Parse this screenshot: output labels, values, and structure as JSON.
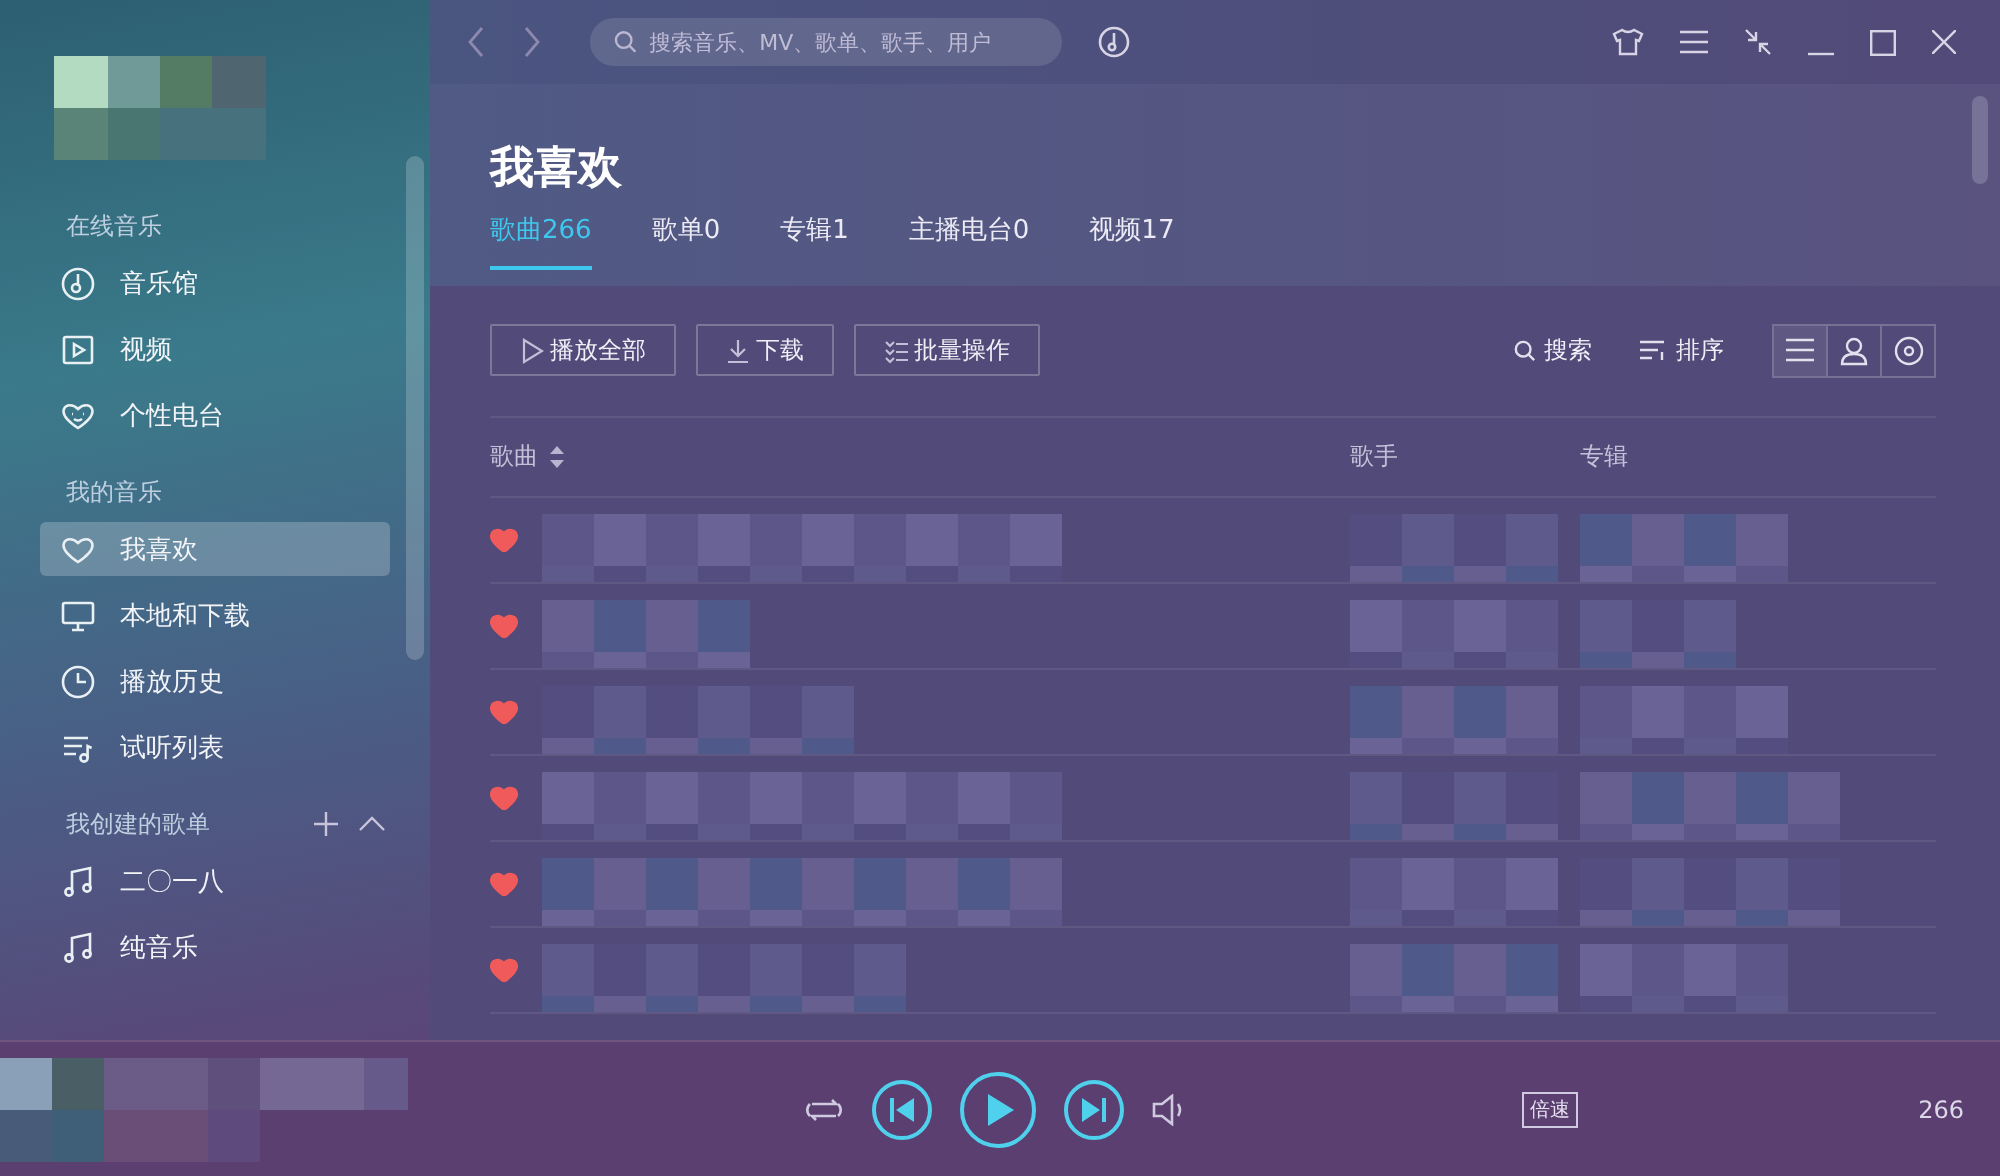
{
  "topbar": {
    "search": {
      "placeholder": "搜索音乐、MV、歌单、歌手、用户"
    }
  },
  "sidebar": {
    "sections": [
      {
        "title": "在线音乐",
        "items": [
          {
            "label": "音乐馆",
            "selected": false
          },
          {
            "label": "视频",
            "selected": false
          },
          {
            "label": "个性电台",
            "selected": false
          }
        ]
      },
      {
        "title": "我的音乐",
        "items": [
          {
            "label": "我喜欢",
            "selected": true
          },
          {
            "label": "本地和下载",
            "selected": false
          },
          {
            "label": "播放历史",
            "selected": false
          },
          {
            "label": "试听列表",
            "selected": false
          }
        ]
      },
      {
        "title": "我创建的歌单",
        "actions": true,
        "items": [
          {
            "label": "二〇一八",
            "selected": false
          },
          {
            "label": "纯音乐",
            "selected": false
          }
        ]
      }
    ]
  },
  "page": {
    "title": "我喜欢",
    "tabs": [
      {
        "label": "歌曲266",
        "selected": true
      },
      {
        "label": "歌单0",
        "selected": false
      },
      {
        "label": "专辑1",
        "selected": false
      },
      {
        "label": "主播电台0",
        "selected": false
      },
      {
        "label": "视频17",
        "selected": false
      }
    ]
  },
  "toolbar": {
    "buttons": [
      {
        "label": "播放全部"
      },
      {
        "label": "下载"
      },
      {
        "label": "批量操作"
      }
    ],
    "search": "搜索",
    "sort": "排序"
  },
  "table": {
    "columns": [
      "歌曲",
      "歌手",
      "专辑"
    ],
    "rows": [
      {
        "liked": true,
        "kind": "picture"
      },
      {
        "liked": true,
        "kind": "picture"
      },
      {
        "liked": true,
        "kind": "picture"
      },
      {
        "liked": true,
        "kind": "picture"
      },
      {
        "liked": true,
        "kind": "picture"
      },
      {
        "liked": true,
        "kind": "picture"
      }
    ]
  },
  "player": {
    "speed": "倍速",
    "count": "266"
  }
}
